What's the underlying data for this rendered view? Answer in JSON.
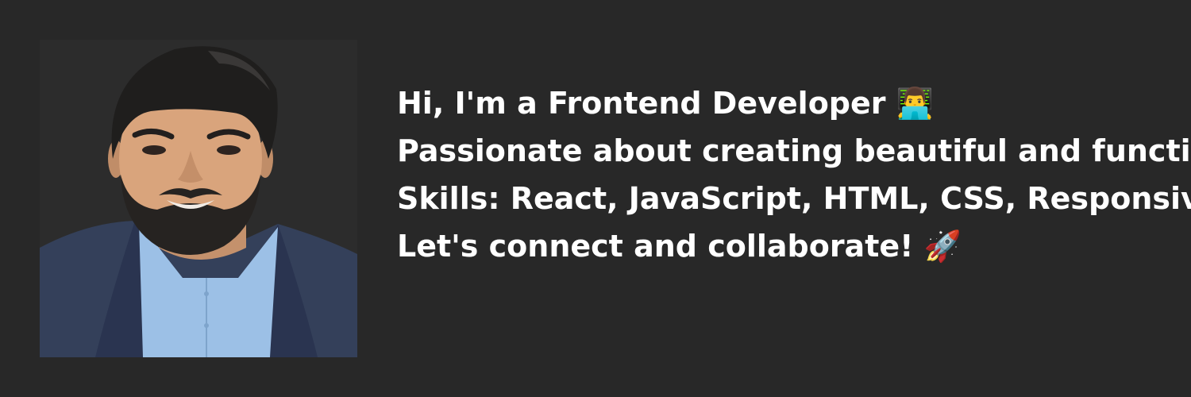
{
  "profile": {
    "lines": [
      "Hi, I'm a Frontend Developer 👨‍💻",
      "Passionate about creating beautiful and functional web experiences",
      "Skills: React, JavaScript, HTML, CSS, Responsive Design",
      "Let's connect and collaborate! 🚀"
    ]
  },
  "colors": {
    "background": "#282828",
    "text": "#ffffff",
    "photo_background": "#2c2c2c",
    "jacket": "#34405a",
    "shirt": "#9cc0e6"
  }
}
